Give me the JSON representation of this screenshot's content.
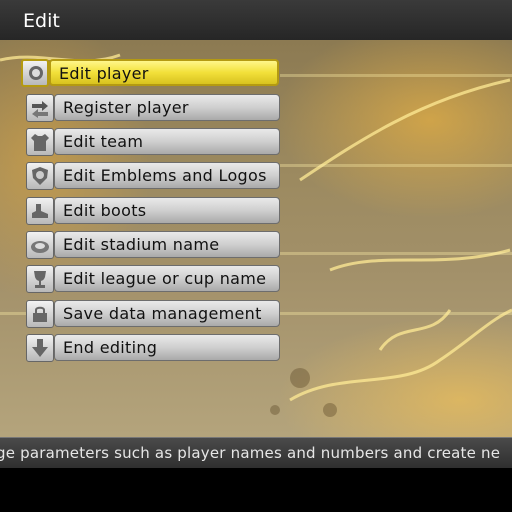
{
  "window": {
    "title": "Edit"
  },
  "menu": {
    "selected_index": 0,
    "items": [
      {
        "label": "Edit player",
        "icon": "player-face-icon"
      },
      {
        "label": "Register player",
        "icon": "register-arrows-icon"
      },
      {
        "label": "Edit team",
        "icon": "jersey-icon"
      },
      {
        "label": "Edit Emblems and Logos",
        "icon": "emblem-shield-icon"
      },
      {
        "label": "Edit boots",
        "icon": "boot-icon"
      },
      {
        "label": "Edit stadium name",
        "icon": "stadium-icon"
      },
      {
        "label": "Edit league or cup name",
        "icon": "trophy-icon"
      },
      {
        "label": "Save data management",
        "icon": "save-lock-icon"
      },
      {
        "label": "End editing",
        "icon": "down-arrow-icon"
      }
    ]
  },
  "help": {
    "text": "ge parameters such as player names and numbers and create ne"
  },
  "colors": {
    "selected": "#f2e03a",
    "item": "#cfcfcf",
    "bar": "#3a3a3a"
  }
}
